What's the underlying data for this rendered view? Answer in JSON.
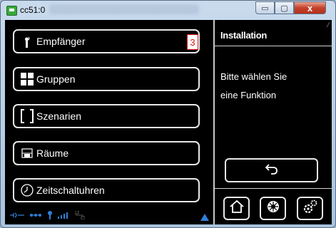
{
  "window": {
    "title": "cc51:0",
    "minimize_glyph": "▭",
    "maximize_glyph": "▢",
    "close_glyph": "x"
  },
  "menu": {
    "items": [
      {
        "label": "Empfänger",
        "icon": "antenna-icon",
        "badge": "3"
      },
      {
        "label": "Gruppen",
        "icon": "grid-icon"
      },
      {
        "label": "Szenarien",
        "icon": "brackets-icon"
      },
      {
        "label": "Räume",
        "icon": "room-icon"
      },
      {
        "label": "Zeitschaltuhren",
        "icon": "clock-icon"
      }
    ]
  },
  "panel": {
    "title": "Installation",
    "line1": "Bitte wählen Sie",
    "line2": "eine Funktion"
  },
  "footer": {
    "buttons": [
      "home-icon",
      "sun-icon",
      "settings-icon"
    ]
  },
  "colors": {
    "background": "#000000",
    "text": "#ffffff",
    "badge": "#e01010",
    "status": "#2f7fd6"
  }
}
